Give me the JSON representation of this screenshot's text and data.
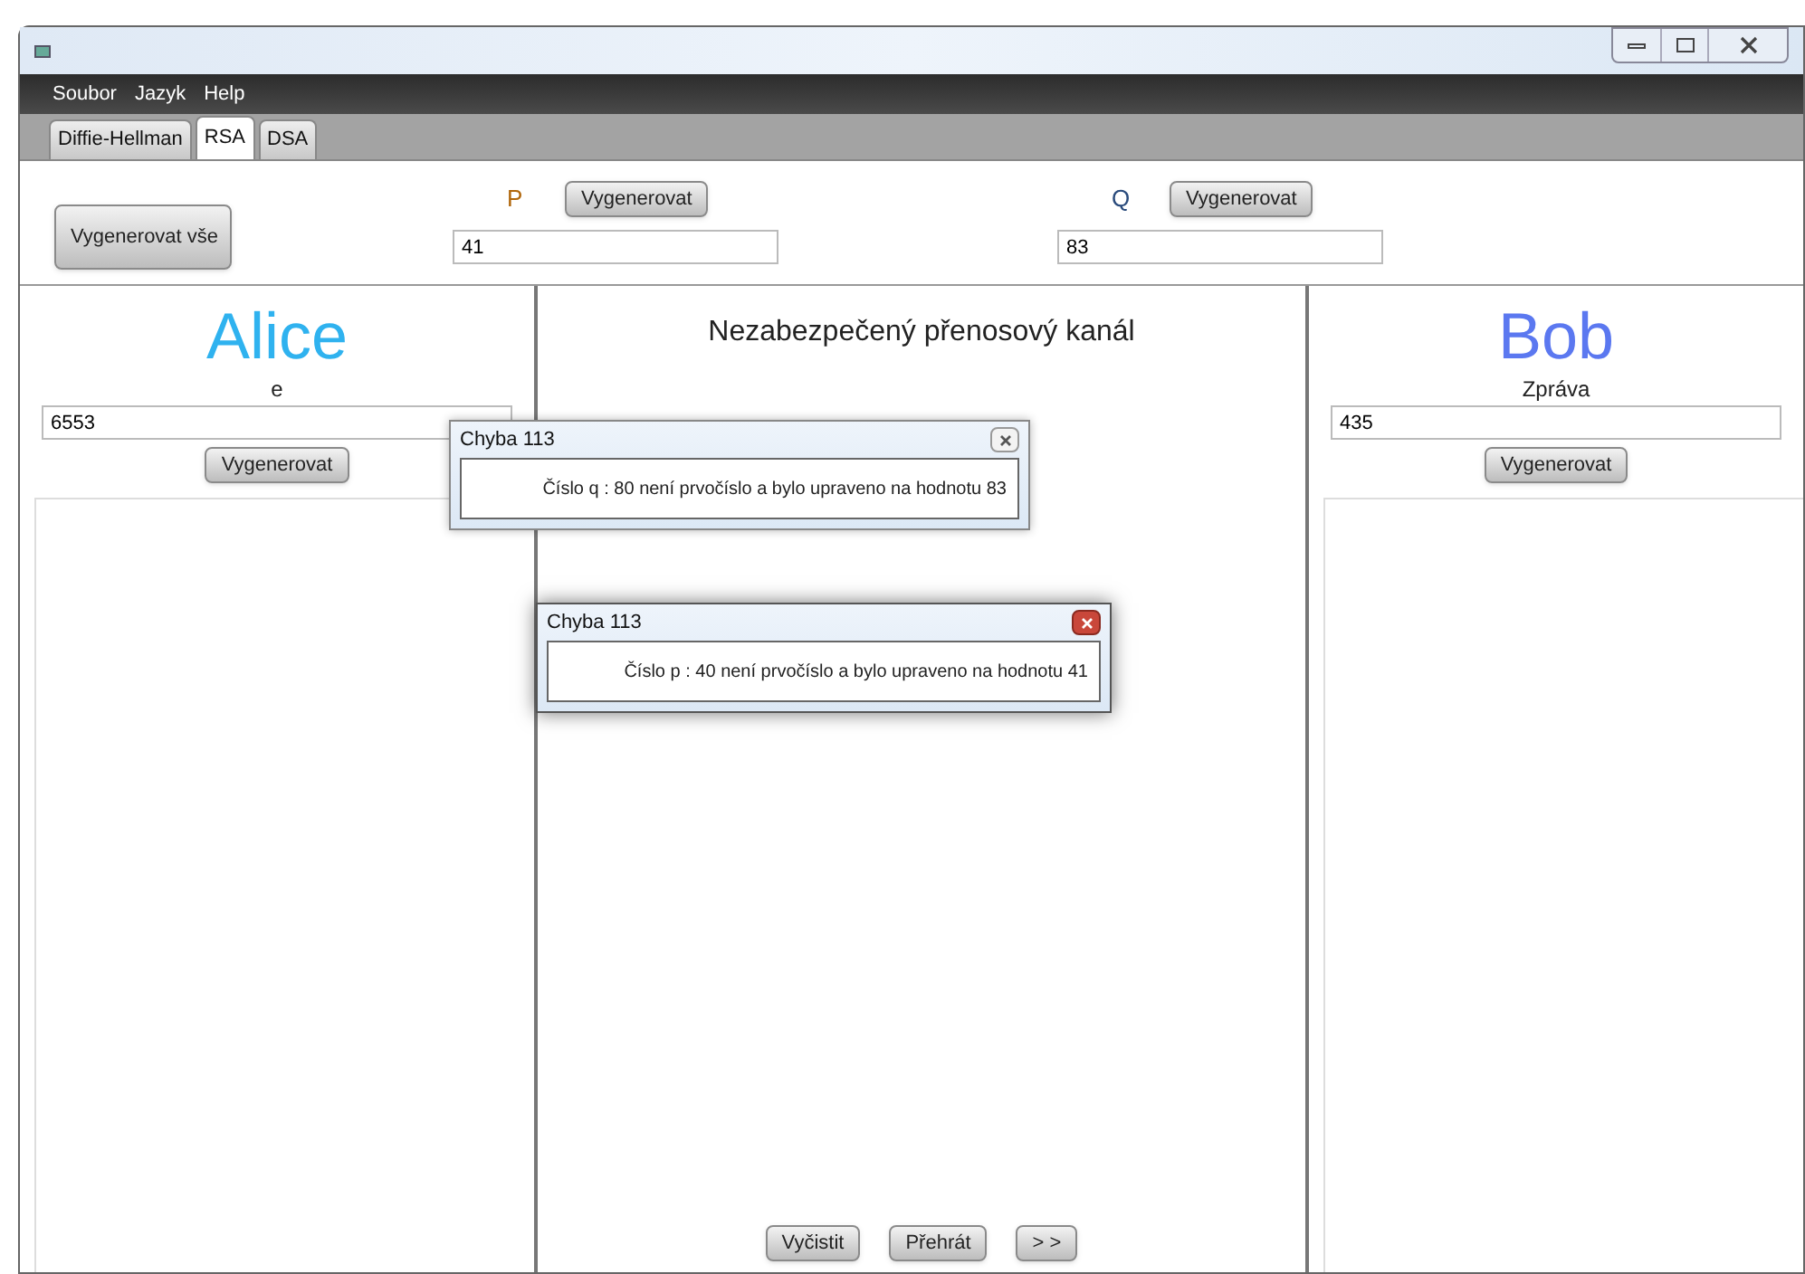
{
  "menu": [
    "Soubor",
    "Jazyk",
    "Help"
  ],
  "tabs": [
    {
      "label": "Diffie-Hellman",
      "selected": false
    },
    {
      "label": "RSA",
      "selected": true
    },
    {
      "label": "DSA",
      "selected": false
    }
  ],
  "generate_all_button": "Vygenerovat vše",
  "params": [
    {
      "label": "P",
      "button": "Vygenerovat",
      "value": "41",
      "color": "#b0660a"
    },
    {
      "label": "Q",
      "button": "Vygenerovat",
      "value": "83",
      "color": "#2a4b7c"
    }
  ],
  "alice": {
    "name": "Alice",
    "field_label": "e",
    "value": "6553",
    "button": "Vygenerovat"
  },
  "channel": {
    "title": "Nezabezpečený přenosový kanál",
    "buttons": [
      "Vyčistit",
      "Přehrát",
      "> >"
    ]
  },
  "bob": {
    "name": "Bob",
    "field_label": "Zpráva",
    "value": "435",
    "button": "Vygenerovat"
  },
  "dialogs": [
    {
      "title": "Chyba 113",
      "message": "Číslo q : 80 není prvočíslo a bylo upraveno na hodnotu 83",
      "active": false
    },
    {
      "title": "Chyba 113",
      "message": "Číslo p : 40 není prvočíslo a bylo upraveno na hodnotu 41",
      "active": true
    }
  ]
}
